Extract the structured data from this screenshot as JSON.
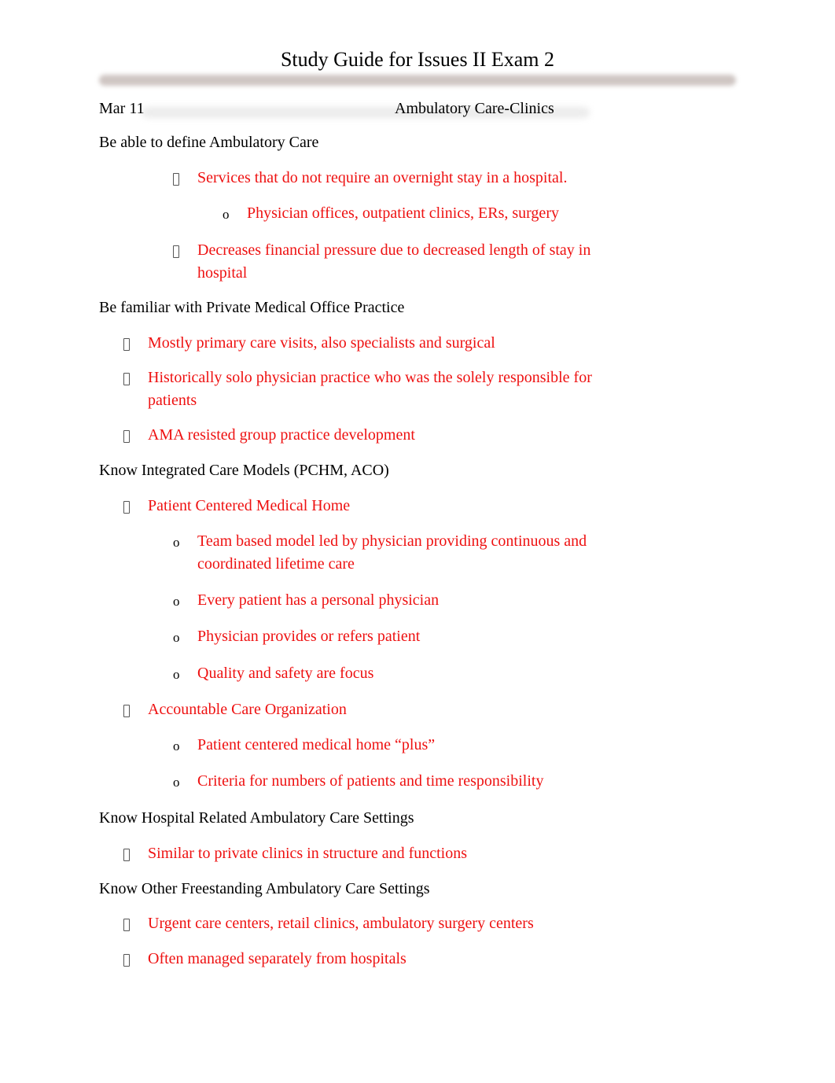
{
  "document": {
    "title": "Study Guide for Issues II Exam 2",
    "date": "Mar 11",
    "topic": "Ambulatory Care-Clinics"
  },
  "sections": [
    {
      "heading": "Be able to define Ambulatory Care",
      "items": [
        {
          "text": "Services that do not require an overnight stay in a hospital.",
          "level": 1,
          "children": [
            {
              "text": "Physician offices, outpatient clinics, ERs, surgery",
              "level": 2
            }
          ]
        },
        {
          "text": "Decreases financial pressure due to decreased length of stay in hospital",
          "level": 1
        }
      ]
    },
    {
      "heading": "Be familiar with Private Medical Office Practice",
      "items": [
        {
          "text": "Mostly primary care visits, also specialists and surgical",
          "level": 1
        },
        {
          "text": "Historically solo physician practice who was the solely responsible for patients",
          "level": 1
        },
        {
          "text": "AMA resisted group practice development",
          "level": 1
        }
      ]
    },
    {
      "heading": "Know Integrated Care Models (PCHM, ACO)",
      "items": [
        {
          "text": "Patient Centered Medical Home",
          "level": 1,
          "children": [
            {
              "text": "Team based model led by physician providing continuous and coordinated lifetime care",
              "level": 2
            },
            {
              "text": "Every patient has a personal physician",
              "level": 2
            },
            {
              "text": "Physician provides or refers patient",
              "level": 2
            },
            {
              "text": "Quality and safety are focus",
              "level": 2
            }
          ]
        },
        {
          "text": "Accountable Care Organization",
          "level": 1,
          "children": [
            {
              "text": "Patient centered medical home “plus”",
              "level": 2
            },
            {
              "text": "Criteria for numbers of patients and time responsibility",
              "level": 2
            }
          ]
        }
      ]
    },
    {
      "heading": "Know Hospital Related Ambulatory Care Settings",
      "items": [
        {
          "text": "Similar to private clinics in structure and functions",
          "level": 1
        }
      ]
    },
    {
      "heading": "Know Other Freestanding Ambulatory Care Settings",
      "items": [
        {
          "text": "Urgent care centers, retail clinics, ambulatory surgery centers",
          "level": 1
        },
        {
          "text": "Often managed separately from hospitals",
          "level": 1
        }
      ]
    }
  ],
  "bullet_glyphs": {
    "level1": "missing-glyph-box",
    "level2": "o"
  },
  "colors": {
    "answer_text": "#ee1111",
    "heading_text": "#000000",
    "blur_bar": "#cfc6c3"
  }
}
